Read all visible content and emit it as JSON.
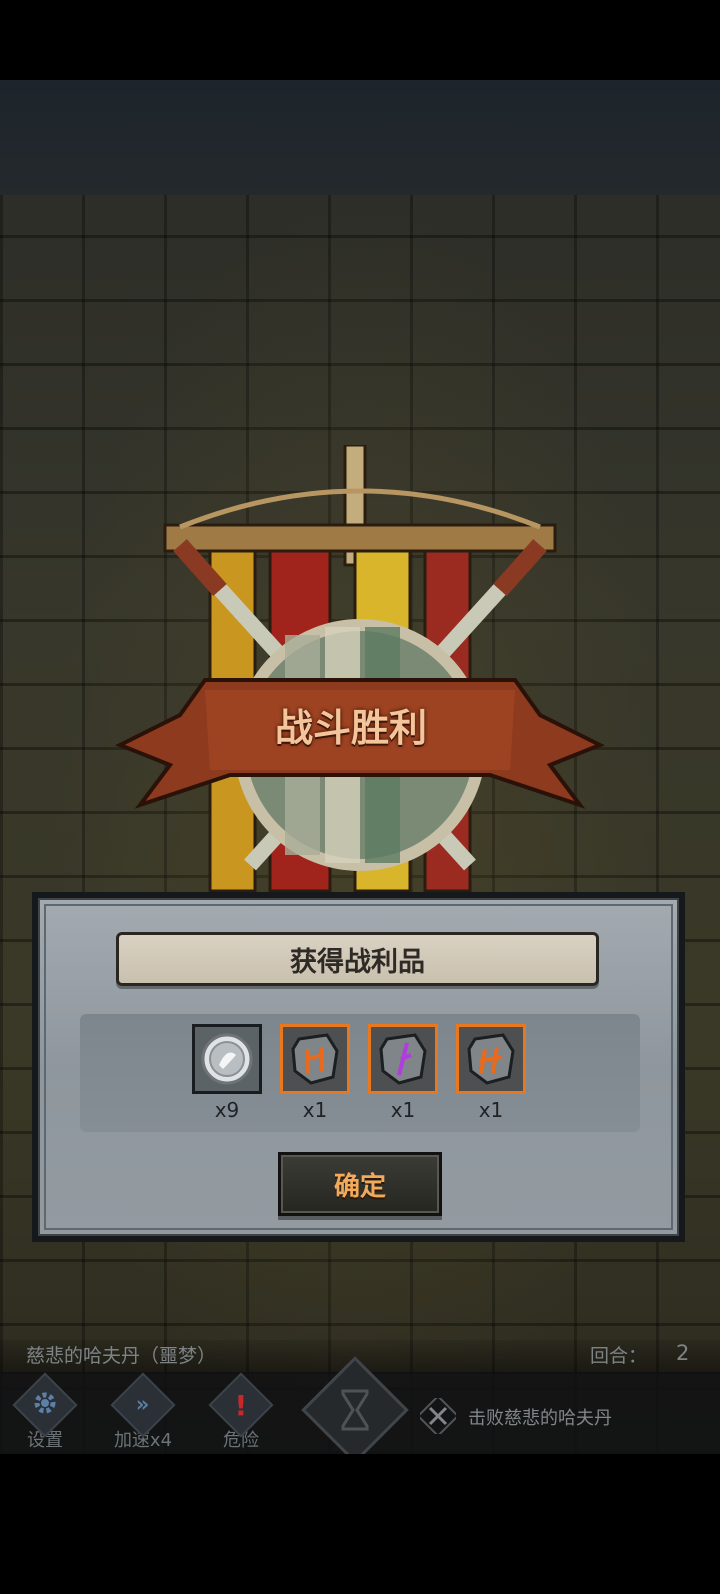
{
  "victory": {
    "title": "战斗胜利"
  },
  "loot_dialog": {
    "header": "获得战利品",
    "items": [
      {
        "icon": "silver-coin-icon",
        "count": "x9",
        "frame": "grey"
      },
      {
        "icon": "orange-rune-stone-icon",
        "count": "x1",
        "frame": "orange"
      },
      {
        "icon": "purple-rune-stone-icon",
        "count": "x1",
        "frame": "orange"
      },
      {
        "icon": "orange-rune-stone-icon",
        "count": "x1",
        "frame": "orange"
      }
    ],
    "confirm_label": "确定"
  },
  "status_bar": {
    "boss_name": "慈悲的哈夫丹（噩梦）",
    "round_label": "回合：",
    "round_value": "2"
  },
  "hud": {
    "settings_label": "设置",
    "speed_label": "加速x4",
    "danger_label": "危险",
    "objective": "击败慈悲的哈夫丹"
  },
  "colors": {
    "title_text": "#f4c59a",
    "confirm_text": "#f1aa5c",
    "item_frame_orange": "#e8771e",
    "danger_red": "#c8282a"
  }
}
